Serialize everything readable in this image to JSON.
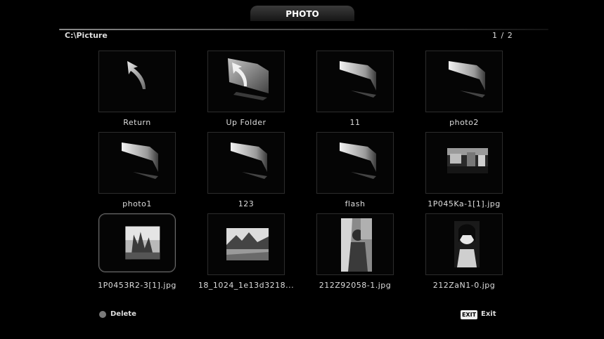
{
  "header": {
    "title": "PHOTO"
  },
  "path": {
    "current": "C:\\Picture",
    "page": "1 / 2"
  },
  "items": [
    {
      "label": "Return",
      "kind": "return"
    },
    {
      "label": "Up Folder",
      "kind": "up-folder"
    },
    {
      "label": "11",
      "kind": "folder"
    },
    {
      "label": "photo2",
      "kind": "folder"
    },
    {
      "label": "photo1",
      "kind": "folder"
    },
    {
      "label": "123",
      "kind": "folder"
    },
    {
      "label": "flash",
      "kind": "folder"
    },
    {
      "label": "1P045Ka-1[1].jpg",
      "kind": "image"
    },
    {
      "label": "1P0453R2-3[1].jpg",
      "kind": "image",
      "selected": true
    },
    {
      "label": "18_1024_1e13d3218...",
      "kind": "image"
    },
    {
      "label": "212Z92058-1.jpg",
      "kind": "image"
    },
    {
      "label": "212ZaN1-0.jpg",
      "kind": "image"
    }
  ],
  "footer": {
    "delete_label": "Delete",
    "exit_key": "EXIT",
    "exit_label": "Exit"
  }
}
